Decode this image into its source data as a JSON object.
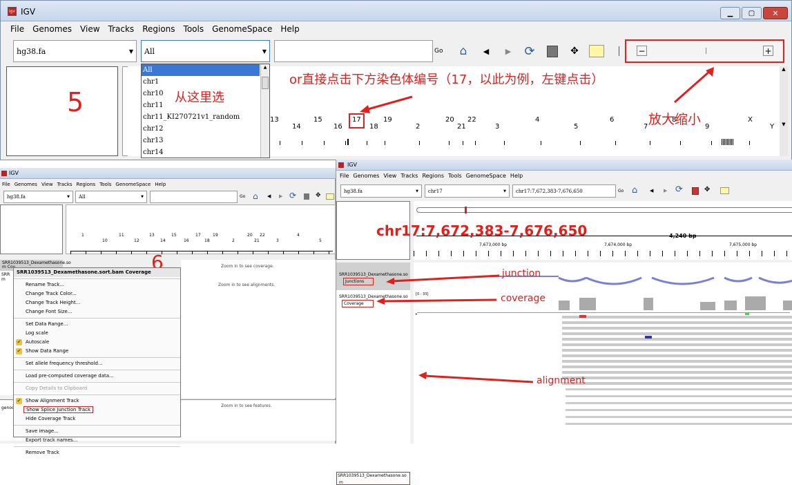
{
  "top": {
    "title": "IGV",
    "menu": [
      "File",
      "Genomes",
      "View",
      "Tracks",
      "Regions",
      "Tools",
      "GenomeSpace",
      "Help"
    ],
    "genome": "hg38.fa",
    "chrom": "All",
    "go": "Go",
    "dropdown": [
      "All",
      "chr1",
      "chr10",
      "chr11",
      "chr11_KI270721v1_random",
      "chr12",
      "chr13",
      "chr14"
    ],
    "chromosomes": [
      "13",
      "14",
      "15",
      "16",
      "17",
      "18",
      "19",
      "2",
      "20",
      "21",
      "22",
      "3",
      "4",
      "5",
      "6",
      "7",
      "8",
      "9",
      "X",
      "Y"
    ],
    "annot_number": "5",
    "annot_select": "从这里选",
    "annot_click": "or直接点击下方染色体编号（17，以此为例，左键点击）",
    "annot_zoom": "放大缩小"
  },
  "left": {
    "title": "IGV",
    "menu": [
      "File",
      "Genomes",
      "View",
      "Tracks",
      "Regions",
      "Tools",
      "GenomeSpace",
      "Help"
    ],
    "genome": "hg38.fa",
    "chrom": "All",
    "go": "Go",
    "chromosomes": [
      "1",
      "10",
      "11",
      "12",
      "13",
      "14",
      "15",
      "16",
      "17",
      "18",
      "19",
      "2",
      "20",
      "21",
      "22",
      "3",
      "4",
      "5"
    ],
    "annot_number": "6",
    "track_name": "SRR1039513_Dexamethasone.so",
    "track_sub": "m Cov",
    "side_label_1": "SRR",
    "side_label_2": "m",
    "zoom_cov": "Zoom in to see coverage.",
    "zoom_aln": "Zoom in to see alignments.",
    "zoom_feat": "Zoom in to see features.",
    "genes_label": "genoc",
    "ctx_title": "SRR1039513_Dexamethasone.sort.bam Coverage",
    "ctx_items": [
      "Rename Track...",
      "Change Track Color...",
      "Change Track Height...",
      "Change Font Size...",
      "Set Data Range...",
      "Log scale",
      "Autoscale",
      "Show Data Range",
      "Set allele frequency threshold...",
      "Load pre-computed coverage data...",
      "Copy Details to Clipboard",
      "Show Alignment Track",
      "Show Splice Junction Track",
      "Hide Coverage Track",
      "Save image...",
      "Export track names...",
      "Remove Track"
    ]
  },
  "right": {
    "title": "IGV",
    "menu": [
      "File",
      "Genomes",
      "View",
      "Tracks",
      "Regions",
      "Tools",
      "GenomeSpace",
      "Help"
    ],
    "genome": "hg38.fa",
    "chrom": "chr17",
    "locus": "chr17:7,672,383-7,676,650",
    "go": "Go",
    "annot_locus": "chr17:7,672,383-7,676,650",
    "span": "4,240 bp",
    "ruler": [
      "7,673,000 bp",
      "7,674,000 bp",
      "7,675,000 bp"
    ],
    "track1": "SRR1039513_Dexamethasone.so",
    "track1_sub": "Junctions",
    "track2": "SRR1039513_Dexamethasone.so",
    "track2_sub": "Coverage",
    "track3": "SRR1039513_Dexamethasone.so",
    "track3_sub": "m",
    "data_range": "[0 - 33]",
    "annot_junction": "junction",
    "annot_coverage": "coverage",
    "annot_alignment": "alignment"
  }
}
